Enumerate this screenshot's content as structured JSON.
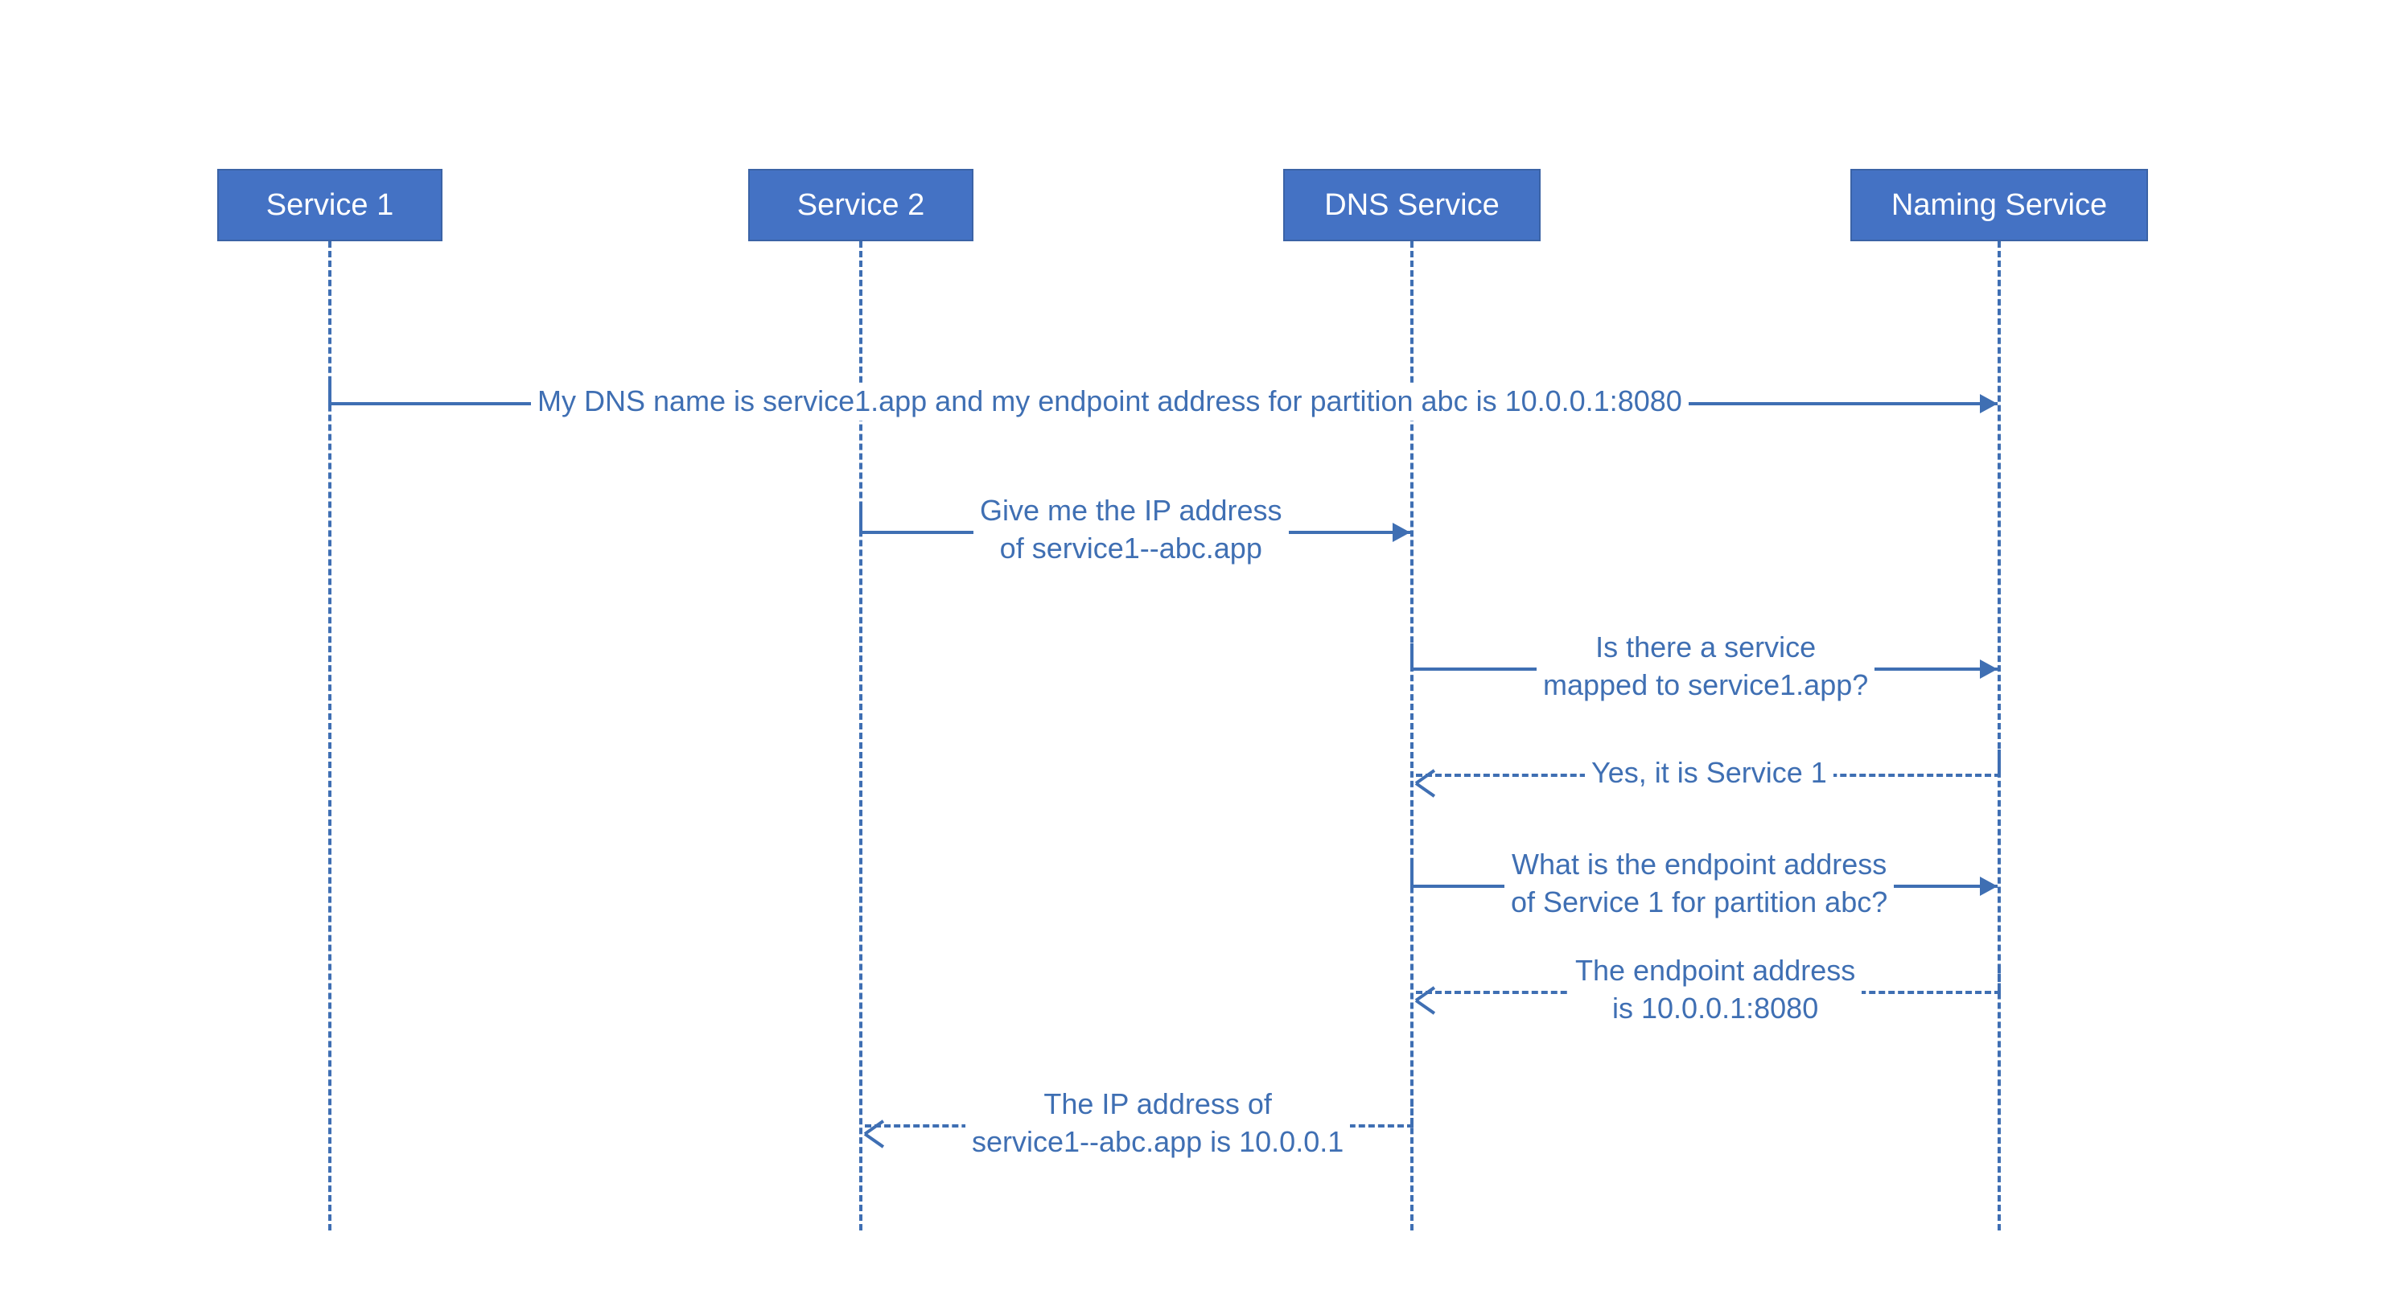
{
  "participants": {
    "p1": "Service 1",
    "p2": "Service 2",
    "p3": "DNS Service",
    "p4": "Naming Service"
  },
  "messages": {
    "m1": "My DNS name is service1.app and my endpoint address for partition abc is 10.0.0.1:8080",
    "m2a": "Give me the IP address",
    "m2b": "of service1--abc.app",
    "m3a": "Is there a service",
    "m3b": "mapped to service1.app?",
    "m4": "Yes, it is Service 1",
    "m5a": "What is the endpoint address",
    "m5b": "of Service 1 for partition abc?",
    "m6a": "The endpoint address",
    "m6b": "is 10.0.0.1:8080",
    "m7a": "The IP address of",
    "m7b": "service1--abc.app is 10.0.0.1"
  }
}
